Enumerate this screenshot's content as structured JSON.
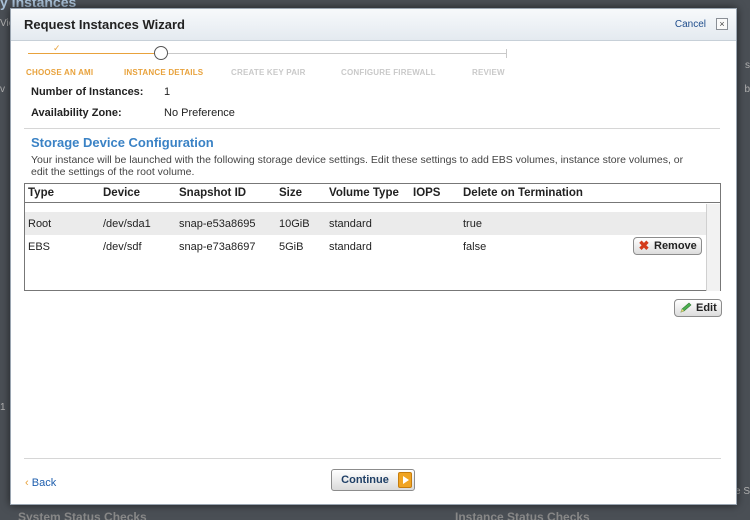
{
  "background": {
    "title_fragment": "y Instances",
    "left_fragments": [
      "Vie",
      "v",
      "1"
    ],
    "right_fragments": [
      "s",
      "b",
      "e S"
    ],
    "bottom_left_heading": "System Status Checks",
    "bottom_right_heading": "Instance Status Checks"
  },
  "modal": {
    "title": "Request Instances Wizard",
    "cancel_label": "Cancel",
    "close_glyph": "×"
  },
  "steps": [
    {
      "label": "CHOOSE AN AMI",
      "state": "done",
      "check": "✓"
    },
    {
      "label": "INSTANCE DETAILS",
      "state": "active"
    },
    {
      "label": "CREATE KEY PAIR",
      "state": "pending"
    },
    {
      "label": "CONFIGURE FIREWALL",
      "state": "pending"
    },
    {
      "label": "REVIEW",
      "state": "pending"
    }
  ],
  "details": {
    "instances_label": "Number of Instances:",
    "instances_value": "1",
    "zone_label": "Availability Zone:",
    "zone_value": "No Preference"
  },
  "storage": {
    "title": "Storage Device Configuration",
    "description": "Your instance will be launched with the following storage device settings. Edit these settings to add EBS volumes, instance store volumes, or edit the settings of the root volume.",
    "columns": [
      "Type",
      "Device",
      "Snapshot ID",
      "Size",
      "Volume Type",
      "IOPS",
      "Delete on Termination"
    ],
    "rows": [
      {
        "type": "Root",
        "device": "/dev/sda1",
        "snapshot": "snap-e53a8695",
        "size": "10GiB",
        "volume_type": "standard",
        "iops": "",
        "delete": "true"
      },
      {
        "type": "EBS",
        "device": "/dev/sdf",
        "snapshot": "snap-e73a8697",
        "size": "5GiB",
        "volume_type": "standard",
        "iops": "",
        "delete": "false",
        "action": "Remove"
      }
    ],
    "edit_label": "Edit"
  },
  "footer": {
    "back_label": "Back",
    "back_glyph": "‹",
    "continue_label": "Continue"
  },
  "colors": {
    "accent_orange": "#e8a23c",
    "section_blue": "#3a82c5",
    "link_blue": "#1f5fae",
    "remove_red": "#d43a1a"
  }
}
